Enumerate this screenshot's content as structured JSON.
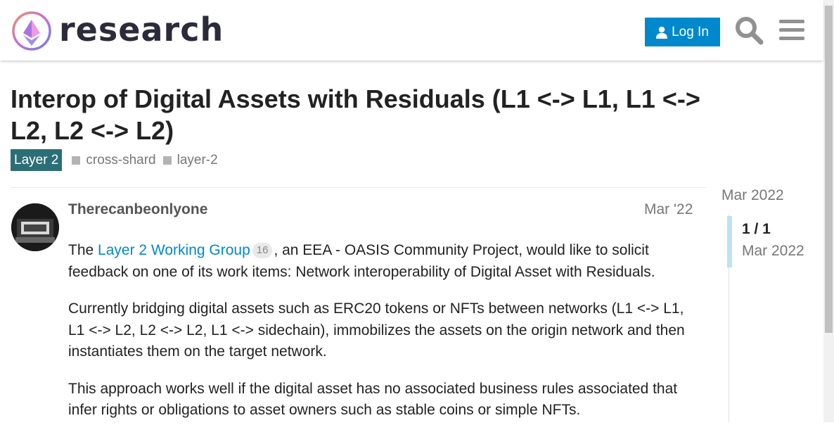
{
  "header": {
    "site_name": "research",
    "login_label": "Log In"
  },
  "topic": {
    "title": "Interop of Digital Assets with Residuals (L1 <-> L1, L1 <-> L2, L2 <-> L2)",
    "category": "Layer 2",
    "category_color": "#2c6e75",
    "tags": [
      "cross-shard",
      "layer-2"
    ]
  },
  "post": {
    "username": "Therecanbeonlyone",
    "date": "Mar '22",
    "p1_before": "The ",
    "p1_link": "Layer 2 Working Group",
    "p1_link_count": "16",
    "p1_after": ", an EEA - OASIS Community Project, would like to solicit feedback on one of its work items: Network interoperability of Digital Asset with Residuals.",
    "p2": "Currently bridging digital assets such as ERC20 tokens or NFTs between networks (L1 <-> L1, L1 <-> L2, L2 <-> L2, L1 <-> sidechain), immobilizes the assets on the origin network and then instantiates them on the target network.",
    "p3": "This approach works well if the digital asset has no associated business rules associated that infer rights or obligations to asset owners such as stable coins or simple NFTs."
  },
  "timeline": {
    "start_date": "Mar 2022",
    "position": "1 / 1",
    "current_date": "Mar 2022"
  },
  "colors": {
    "accent": "#0088cc",
    "timeline_handle": "#bfe1f3"
  }
}
